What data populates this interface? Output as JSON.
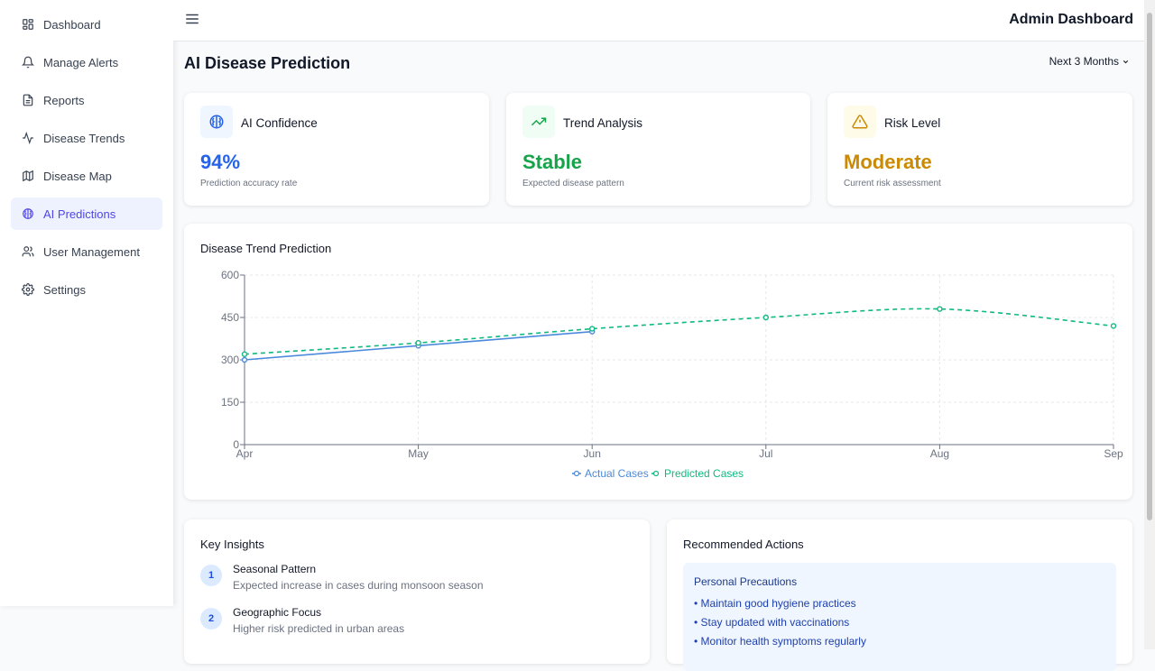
{
  "sidebar": {
    "items": [
      {
        "label": "Dashboard",
        "icon": "dashboard-icon",
        "active": false
      },
      {
        "label": "Manage Alerts",
        "icon": "bell-icon",
        "active": false
      },
      {
        "label": "Reports",
        "icon": "file-text-icon",
        "active": false
      },
      {
        "label": "Disease Trends",
        "icon": "activity-icon",
        "active": false
      },
      {
        "label": "Disease Map",
        "icon": "map-icon",
        "active": false
      },
      {
        "label": "AI Predictions",
        "icon": "brain-icon",
        "active": true
      },
      {
        "label": "User Management",
        "icon": "users-icon",
        "active": false
      },
      {
        "label": "Settings",
        "icon": "gear-icon",
        "active": false
      }
    ]
  },
  "header": {
    "title": "Admin Dashboard"
  },
  "page": {
    "title": "AI Disease Prediction",
    "range_label": "Next 3 Months"
  },
  "stats": [
    {
      "label": "AI Confidence",
      "value": "94%",
      "sub": "Prediction accuracy rate",
      "color": "#2563eb",
      "bg": "#eff6ff",
      "icon": "brain-icon"
    },
    {
      "label": "Trend Analysis",
      "value": "Stable",
      "sub": "Expected disease pattern",
      "color": "#16a34a",
      "bg": "#f0fdf4",
      "icon": "trending-up-icon"
    },
    {
      "label": "Risk Level",
      "value": "Moderate",
      "sub": "Current risk assessment",
      "color": "#ca8a04",
      "bg": "#fefce8",
      "icon": "warning-icon"
    }
  ],
  "chart": {
    "title": "Disease Trend Prediction"
  },
  "chart_data": {
    "type": "line",
    "categories": [
      "Apr",
      "May",
      "Jun",
      "Jul",
      "Aug",
      "Sep"
    ],
    "ylim": [
      0,
      600
    ],
    "yticks": [
      0,
      150,
      300,
      450,
      600
    ],
    "grid": true,
    "legend": "bottom",
    "series": [
      {
        "name": "Actual Cases",
        "color": "#4a89dc",
        "dashed": false,
        "values": [
          300,
          350,
          400,
          null,
          null,
          null
        ]
      },
      {
        "name": "Predicted Cases",
        "color": "#10b981",
        "dashed": true,
        "values": [
          320,
          360,
          410,
          450,
          480,
          420
        ]
      }
    ]
  },
  "insights": {
    "title": "Key Insights",
    "items": [
      {
        "num": "1",
        "title": "Seasonal Pattern",
        "desc": "Expected increase in cases during monsoon season"
      },
      {
        "num": "2",
        "title": "Geographic Focus",
        "desc": "Higher risk predicted in urban areas"
      }
    ]
  },
  "actions": {
    "title": "Recommended Actions",
    "box_title": "Personal Precautions",
    "items": [
      "• Maintain good hygiene practices",
      "• Stay updated with vaccinations",
      "• Monitor health symptoms regularly"
    ]
  }
}
